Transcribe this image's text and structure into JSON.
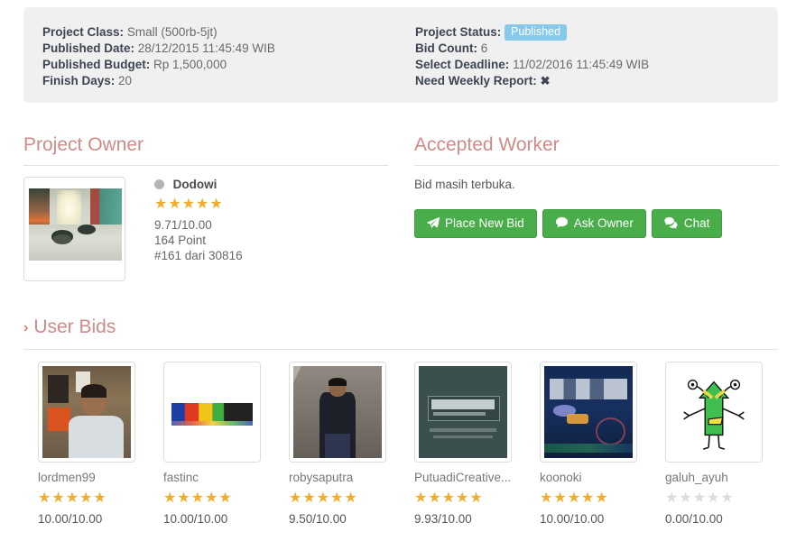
{
  "info_panel": {
    "left": [
      {
        "label": "Project Class:",
        "value": "Small (500rb-5jt)"
      },
      {
        "label": "Published Date:",
        "value": "28/12/2015 11:45:49 WIB"
      },
      {
        "label": "Published Budget:",
        "value": "Rp 1,500,000"
      },
      {
        "label": "Finish Days:",
        "value": "20"
      }
    ],
    "right": {
      "status_label": "Project Status:",
      "status_badge": "Published",
      "bid_count_label": "Bid Count:",
      "bid_count_value": "6",
      "select_deadline_label": "Select Deadline:",
      "select_deadline_value": "11/02/2016 11:45:49 WIB",
      "weekly_report_label": "Need Weekly Report:",
      "weekly_report_value": "✖"
    }
  },
  "project_owner": {
    "title": "Project Owner",
    "status": "offline",
    "name": "Dodowi",
    "stars_filled": 5,
    "rating": "9.71/10.00",
    "points": "164 Point",
    "rank": "#161 dari 30816"
  },
  "accepted_worker": {
    "title": "Accepted Worker",
    "note": "Bid masih terbuka.",
    "buttons": [
      {
        "label": "Place New Bid",
        "icon": "paper-plane-icon"
      },
      {
        "label": "Ask Owner",
        "icon": "comment-icon"
      },
      {
        "label": "Chat",
        "icon": "comments-icon"
      }
    ]
  },
  "user_bids": {
    "title": "User Bids",
    "chevron": "›",
    "cards": [
      {
        "name": "lordmen99",
        "stars_filled": 5,
        "rating": "10.00/10.00",
        "art": "av-lordmen"
      },
      {
        "name": "fastinc",
        "stars_filled": 5,
        "rating": "10.00/10.00",
        "art": "av-fastinc"
      },
      {
        "name": "robysaputra",
        "stars_filled": 5,
        "rating": "9.50/10.00",
        "art": "av-roby"
      },
      {
        "name": "PutuadiCreative...",
        "stars_filled": 5,
        "rating": "9.93/10.00",
        "art": "av-putuadi"
      },
      {
        "name": "koonoki",
        "stars_filled": 5,
        "rating": "10.00/10.00",
        "art": "av-koonoki"
      },
      {
        "name": "galuh_ayuh",
        "stars_filled": 0,
        "rating": "0.00/10.00",
        "art": "av-galuh"
      }
    ]
  },
  "colors": {
    "panel_bg": "#f0f0f0",
    "heading": "#cf8b86",
    "badge_info": "#87c9ec",
    "button_success": "#49ad49",
    "star_filled": "#f0ad2e",
    "star_empty": "#dcdcdc"
  }
}
